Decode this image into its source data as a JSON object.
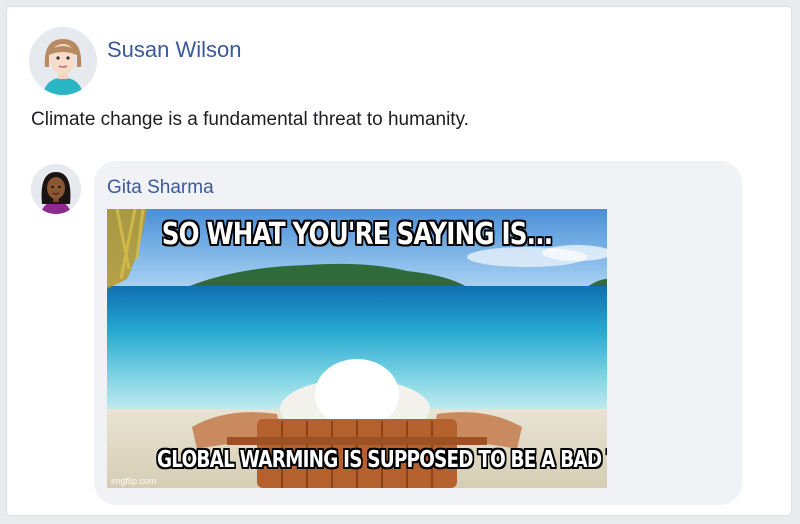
{
  "post": {
    "author": "Susan Wilson",
    "text": "Climate change is a fundamental threat to humanity."
  },
  "reply": {
    "author": "Gita Sharma",
    "meme": {
      "top_caption": "SO WHAT YOU'RE SAYING IS...",
      "bottom_caption": "GLOBAL WARMING IS SUPPOSED TO BE A BAD THING",
      "watermark": "imgflip.com"
    }
  },
  "icons": {
    "main_avatar": "woman-avatar-icon",
    "reply_avatar": "woman-avatar-icon"
  },
  "colors": {
    "name_link": "#3b5998",
    "bubble": "#f0f2f5",
    "text": "#1c1e21"
  }
}
